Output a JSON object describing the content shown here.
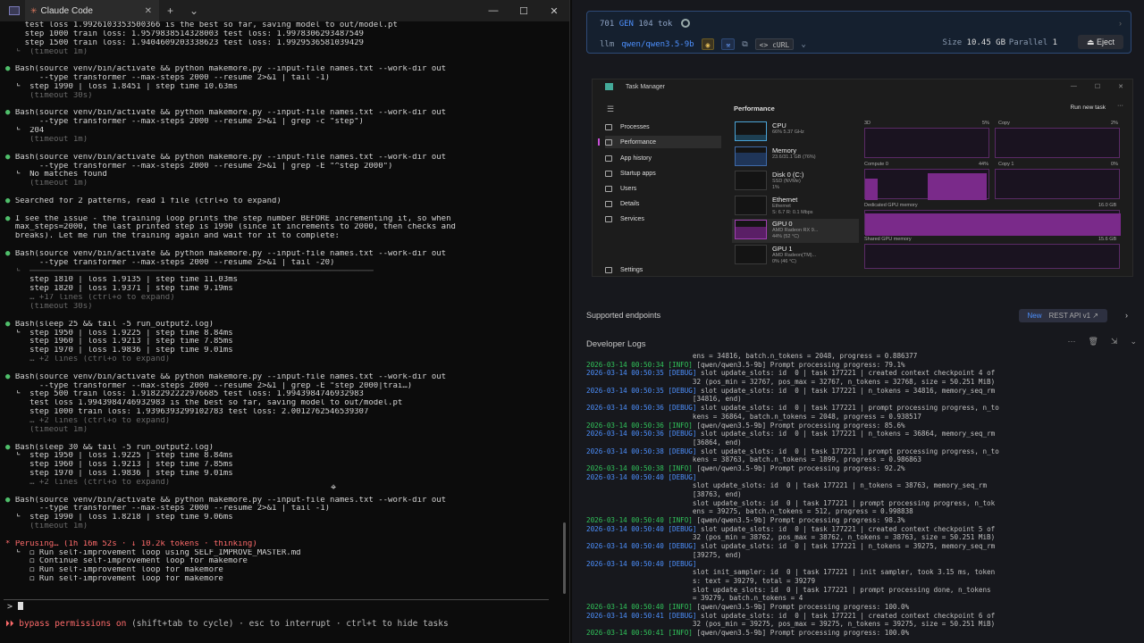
{
  "terminal": {
    "tab_title": "Claude Code",
    "lines": [
      {
        "t": "    test loss 1.9926103353500366 is the best so far, saving model to out/model.pt"
      },
      {
        "t": "    step 1000 train loss: 1.9579838514328003 test loss: 1.9978306293487549"
      },
      {
        "t": "    step 1500 train loss: 1.9404609203338623 test loss: 1.9929536581039429"
      },
      {
        "t": "  └  (timeout 1m)",
        "cls": "dim"
      },
      {
        "t": ""
      },
      {
        "t": "● Bash(source venv/bin/activate && python makemore.py --input-file names.txt --work-dir out",
        "bullet": true
      },
      {
        "t": "       --type transformer --max-steps 2000 --resume 2>&1 | tail -1)"
      },
      {
        "t": "  └  step 1990 | loss 1.8451 | step time 10.63ms"
      },
      {
        "t": "     (timeout 30s)",
        "cls": "dim"
      },
      {
        "t": ""
      },
      {
        "t": "● Bash(source venv/bin/activate && python makemore.py --input-file names.txt --work-dir out",
        "bullet": true
      },
      {
        "t": "       --type transformer --max-steps 2000 --resume 2>&1 | grep -c \"step\")"
      },
      {
        "t": "  └  204"
      },
      {
        "t": "     (timeout 1m)",
        "cls": "dim"
      },
      {
        "t": ""
      },
      {
        "t": "● Bash(source venv/bin/activate && python makemore.py --input-file names.txt --work-dir out",
        "bullet": true
      },
      {
        "t": "       --type transformer --max-steps 2000 --resume 2>&1 | grep -E \"^step 2000\")"
      },
      {
        "t": "  └  No matches found"
      },
      {
        "t": "     (timeout 1m)",
        "cls": "dim"
      },
      {
        "t": ""
      },
      {
        "t": "● Searched for 2 patterns, read 1 file (ctrl+o to expand)",
        "bullet": true
      },
      {
        "t": ""
      },
      {
        "t": "● I see the issue - the training loop prints the step number BEFORE incrementing it, so when",
        "bullet": true
      },
      {
        "t": "  max_steps=2000, the last printed step is 1990 (since it increments to 2000, then checks and"
      },
      {
        "t": "  breaks). Let me run the training again and wait for it to complete:"
      },
      {
        "t": ""
      },
      {
        "t": "● Bash(source venv/bin/activate && python makemore.py --input-file names.txt --work-dir out",
        "bullet": true
      },
      {
        "t": "       --type transformer --max-steps 2000 --resume 2>&1 | tail -20)"
      },
      {
        "t": "  └  ───────────────────────────────────────────────────────────────────────",
        "cls": "dim"
      },
      {
        "t": "     step 1810 | loss 1.9135 | step time 11.03ms"
      },
      {
        "t": "     step 1820 | loss 1.9371 | step time 9.19ms"
      },
      {
        "t": "     … +17 lines (ctrl+o to expand)",
        "cls": "dim"
      },
      {
        "t": "     (timeout 30s)",
        "cls": "dim"
      },
      {
        "t": ""
      },
      {
        "t": "● Bash(sleep 25 && tail -5 run_output2.log)",
        "bullet": true
      },
      {
        "t": "  └  step 1950 | loss 1.9225 | step time 8.84ms"
      },
      {
        "t": "     step 1960 | loss 1.9213 | step time 7.85ms"
      },
      {
        "t": "     step 1970 | loss 1.9836 | step time 9.01ms"
      },
      {
        "t": "     … +2 lines (ctrl+o to expand)",
        "cls": "dim"
      },
      {
        "t": ""
      },
      {
        "t": "● Bash(source venv/bin/activate && python makemore.py --input-file names.txt --work-dir out",
        "bullet": true
      },
      {
        "t": "       --type transformer --max-steps 2000 --resume 2>&1 | grep -E \"step 2000|trai…)"
      },
      {
        "t": "  └  step 500 train loss: 1.9182292222976685 test loss: 1.9943984746932983"
      },
      {
        "t": "     test loss 1.9943984746932983 is the best so far, saving model to out/model.pt"
      },
      {
        "t": "     step 1000 train loss: 1.9396393299102783 test loss: 2.0012762546539307"
      },
      {
        "t": "     … +2 lines (ctrl+o to expand)",
        "cls": "dim"
      },
      {
        "t": "     (timeout 1m)",
        "cls": "dim"
      },
      {
        "t": ""
      },
      {
        "t": "● Bash(sleep 30 && tail -5 run_output2.log)",
        "bullet": true
      },
      {
        "t": "  └  step 1950 | loss 1.9225 | step time 8.84ms"
      },
      {
        "t": "     step 1960 | loss 1.9213 | step time 7.85ms"
      },
      {
        "t": "     step 1970 | loss 1.9836 | step time 9.01ms"
      },
      {
        "t": "     … +2 lines (ctrl+o to expand)",
        "cls": "dim"
      },
      {
        "t": ""
      },
      {
        "t": "● Bash(source venv/bin/activate && python makemore.py --input-file names.txt --work-dir out",
        "bullet": true
      },
      {
        "t": "       --type transformer --max-steps 2000 --resume 2>&1 | tail -1)"
      },
      {
        "t": "  └  step 1990 | loss 1.8218 | step time 9.06ms"
      },
      {
        "t": "     (timeout 1m)",
        "cls": "dim"
      },
      {
        "t": ""
      },
      {
        "t": "* Perusing… (1h 16m 52s · ↓ 10.2k tokens · thinking)",
        "cls": "perusing"
      },
      {
        "t": "  └  ◻ Run self-improvement loop using SELF_IMPROVE_MASTER.md"
      },
      {
        "t": "     ◻ Continue self-improvement loop for makemore"
      },
      {
        "t": "     ◻ Run self-improvement loop for makemore"
      },
      {
        "t": "     ◻ Run self-improvement loop for makemore"
      }
    ],
    "prompt_symbol": ">",
    "status_bypass": "⏵⏵ bypass permissions on",
    "status_rest": " (shift+tab to cycle) · esc to interrupt · ctrl+t to hide tasks"
  },
  "model": {
    "tok_count": "701",
    "gen_label": "GEN",
    "tok_rate": "104 tok",
    "prefix": "llm",
    "name": "qwen/qwen3.5-9b",
    "curl_label": "<> cURL",
    "size_label": "Size",
    "size_value": "10.45 GB",
    "parallel_label": "Parallel",
    "parallel_value": "1",
    "eject_label": "⏏ Eject"
  },
  "task_manager": {
    "title": "Task Manager",
    "nav": [
      "Processes",
      "Performance",
      "App history",
      "Startup apps",
      "Users",
      "Details",
      "Services"
    ],
    "settings": "Settings",
    "heading": "Performance",
    "run_task": "Run new task",
    "devices": [
      {
        "name": "CPU",
        "sub": "66%  5.37 GHz"
      },
      {
        "name": "Memory",
        "sub": "23.6/31.1 GB (76%)"
      },
      {
        "name": "Disk 0 (C:)",
        "sub": "SSD (NVMe)\n1%"
      },
      {
        "name": "Ethernet",
        "sub": "Ethernet\nS: 6.7 R: 0.1 Mbps"
      },
      {
        "name": "GPU 0",
        "sub": "AMD Radeon RX 9...\n44% (52 °C)"
      },
      {
        "name": "GPU 1",
        "sub": "AMD Radeon(TM)...\n0% (46 °C)"
      }
    ],
    "graph_labels": {
      "g3d": "3D",
      "g3d_pct": "5%",
      "copy": "Copy",
      "copy_pct": "2%",
      "compute": "Compute 0",
      "compute_pct": "44%",
      "copy1": "Copy 1",
      "copy1_pct": "0%",
      "dedicated": "Dedicated GPU memory",
      "dedicated_val": "16.0 GB",
      "shared": "Shared GPU memory",
      "shared_val": "15.6 GB"
    }
  },
  "endpoints": {
    "label": "Supported endpoints",
    "new": "New",
    "rest": "REST API v1 ↗"
  },
  "devlogs": {
    "title": "Developer Logs",
    "lines": [
      {
        "ts": "",
        "lv": "",
        "msg": "                          ens = 34816, batch.n_tokens = 2048, progress = 0.886377"
      },
      {
        "ts": "2026-03-14 00:50:34",
        "lv": "[INFO]",
        "msg": " [qwen/qwen3.5-9b] Prompt processing progress: 79.1%"
      },
      {
        "ts": "2026-03-14 00:50:35",
        "lv": "[DEBUG]",
        "msg": " slot update_slots: id  0 | task 177221 | created context checkpoint 4 of"
      },
      {
        "ts": "",
        "lv": "",
        "msg": "                          32 (pos_min = 32767, pos_max = 32767, n_tokens = 32768, size = 50.251 MiB)"
      },
      {
        "ts": "2026-03-14 00:50:35",
        "lv": "[DEBUG]",
        "msg": " slot update_slots: id  0 | task 177221 | n_tokens = 34816, memory_seq_rm"
      },
      {
        "ts": "",
        "lv": "",
        "msg": "                          [34816, end)"
      },
      {
        "ts": "2026-03-14 00:50:36",
        "lv": "[DEBUG]",
        "msg": " slot update_slots: id  0 | task 177221 | prompt processing progress, n_to"
      },
      {
        "ts": "",
        "lv": "",
        "msg": "                          kens = 36864, batch.n_tokens = 2048, progress = 0.938517"
      },
      {
        "ts": "2026-03-14 00:50:36",
        "lv": "[INFO]",
        "msg": " [qwen/qwen3.5-9b] Prompt processing progress: 85.6%"
      },
      {
        "ts": "2026-03-14 00:50:36",
        "lv": "[DEBUG]",
        "msg": " slot update_slots: id  0 | task 177221 | n_tokens = 36864, memory_seq_rm"
      },
      {
        "ts": "",
        "lv": "",
        "msg": "                          [36864, end)"
      },
      {
        "ts": "2026-03-14 00:50:38",
        "lv": "[DEBUG]",
        "msg": " slot update_slots: id  0 | task 177221 | prompt processing progress, n_to"
      },
      {
        "ts": "",
        "lv": "",
        "msg": "                          kens = 38763, batch.n_tokens = 1899, progress = 0.986863"
      },
      {
        "ts": "2026-03-14 00:50:38",
        "lv": "[INFO]",
        "msg": " [qwen/qwen3.5-9b] Prompt processing progress: 92.2%"
      },
      {
        "ts": "2026-03-14 00:50:40",
        "lv": "[DEBUG]",
        "msg": ""
      },
      {
        "ts": "",
        "lv": "",
        "msg": "                          slot update_slots: id  0 | task 177221 | n_tokens = 38763, memory_seq_rm"
      },
      {
        "ts": "",
        "lv": "",
        "msg": "                          [38763, end)"
      },
      {
        "ts": "",
        "lv": "",
        "msg": "                          slot update_slots: id  0 | task 177221 | prompt processing progress, n_tok"
      },
      {
        "ts": "",
        "lv": "",
        "msg": "                          ens = 39275, batch.n_tokens = 512, progress = 0.998838"
      },
      {
        "ts": "2026-03-14 00:50:40",
        "lv": "[INFO]",
        "msg": " [qwen/qwen3.5-9b] Prompt processing progress: 98.3%"
      },
      {
        "ts": "2026-03-14 00:50:40",
        "lv": "[DEBUG]",
        "msg": " slot update_slots: id  0 | task 177221 | created context checkpoint 5 of"
      },
      {
        "ts": "",
        "lv": "",
        "msg": "                          32 (pos_min = 38762, pos_max = 38762, n_tokens = 38763, size = 50.251 MiB)"
      },
      {
        "ts": "2026-03-14 00:50:40",
        "lv": "[DEBUG]",
        "msg": " slot update_slots: id  0 | task 177221 | n_tokens = 39275, memory_seq_rm"
      },
      {
        "ts": "",
        "lv": "",
        "msg": "                          [39275, end)"
      },
      {
        "ts": "2026-03-14 00:50:40",
        "lv": "[DEBUG]",
        "msg": ""
      },
      {
        "ts": "",
        "lv": "",
        "msg": "                          slot init_sampler: id  0 | task 177221 | init sampler, took 3.15 ms, token"
      },
      {
        "ts": "",
        "lv": "",
        "msg": "                          s: text = 39279, total = 39279"
      },
      {
        "ts": "",
        "lv": "",
        "msg": "                          slot update_slots: id  0 | task 177221 | prompt processing done, n_tokens"
      },
      {
        "ts": "",
        "lv": "",
        "msg": "                          = 39279, batch.n_tokens = 4"
      },
      {
        "ts": "2026-03-14 00:50:40",
        "lv": "[INFO]",
        "msg": " [qwen/qwen3.5-9b] Prompt processing progress: 100.0%"
      },
      {
        "ts": "2026-03-14 00:50:41",
        "lv": "[DEBUG]",
        "msg": " slot update_slots: id  0 | task 177221 | created context checkpoint 6 of"
      },
      {
        "ts": "",
        "lv": "",
        "msg": "                          32 (pos_min = 39275, pos_max = 39275, n_tokens = 39275, size = 50.251 MiB)"
      },
      {
        "ts": "2026-03-14 00:50:41",
        "lv": "[INFO]",
        "msg": " [qwen/qwen3.5-9b] Prompt processing progress: 100.0%"
      }
    ]
  }
}
